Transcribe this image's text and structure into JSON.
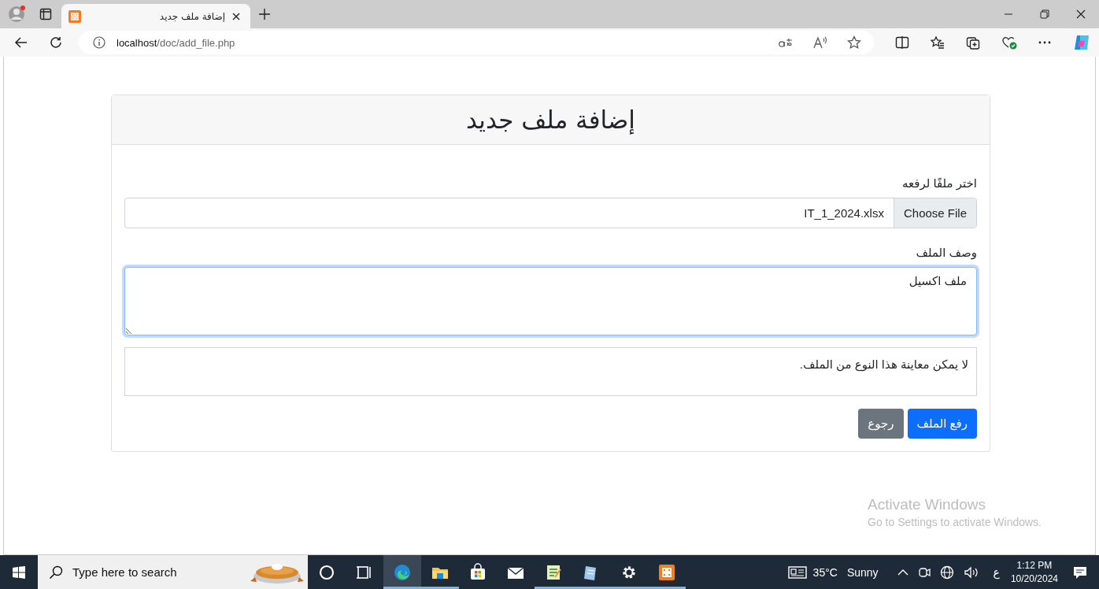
{
  "browser": {
    "tabs": [
      {
        "title": "إضافة ملف جديد",
        "selected": true
      }
    ],
    "address": {
      "host": "localhost",
      "path": "/doc/add_file.php"
    }
  },
  "form": {
    "title": "إضافة ملف جديد",
    "file_label": "اختر ملفًا لرفعه",
    "file_button": "Choose File",
    "file_name": "IT_1_2024.xlsx",
    "description_label": "وصف الملف",
    "description_value": "ملف اكسيل",
    "description_focused": true,
    "preview_text": "لا يمكن معاينة هذا النوع من الملف.",
    "buttons": [
      {
        "label": "رفع الملف",
        "kind": "primary"
      },
      {
        "label": "رجوع",
        "kind": "secondary"
      }
    ]
  },
  "activation": {
    "title": "Activate Windows",
    "subtitle": "Go to Settings to activate Windows."
  },
  "taskbar": {
    "search_placeholder": "Type here to search",
    "apps": [
      {
        "kind": "cortana",
        "running": false,
        "selected": false
      },
      {
        "kind": "taskview",
        "running": false,
        "selected": false
      },
      {
        "kind": "edge",
        "running": true,
        "selected": true
      },
      {
        "kind": "folder",
        "running": true,
        "selected": false
      },
      {
        "kind": "store",
        "running": false,
        "selected": false
      },
      {
        "kind": "mail",
        "running": false,
        "selected": false
      },
      {
        "kind": "notepad",
        "running": true,
        "selected": false
      },
      {
        "kind": "notebook",
        "running": true,
        "selected": false
      },
      {
        "kind": "settings",
        "running": true,
        "selected": false
      },
      {
        "kind": "xampp",
        "running": true,
        "selected": false
      }
    ],
    "weather": {
      "temperature": "35°C",
      "condition": "Sunny"
    },
    "language": "ع",
    "time": "1:12 PM",
    "date": "10/20/2024"
  }
}
